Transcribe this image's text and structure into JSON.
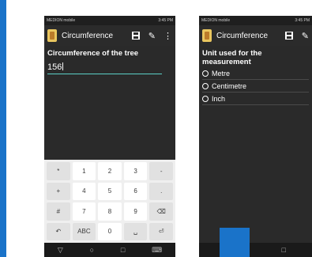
{
  "phone1": {
    "status": {
      "carrier": "MEDION mobile",
      "right": "3:45 PM"
    },
    "appbar": {
      "title": "Circumference"
    },
    "main": {
      "label": "Circumference of the tree",
      "input_value": "156"
    },
    "keyboard": {
      "keys": [
        "*",
        "1",
        "2",
        "3",
        "-",
        "+",
        "4",
        "5",
        "6",
        ".",
        "#",
        "7",
        "8",
        "9",
        "⌫",
        "↶",
        "ABC",
        "0",
        "␣",
        "⏎"
      ]
    },
    "navbar": {
      "back": "▽",
      "home": "○",
      "recent": "□",
      "keyboard": "⌨"
    }
  },
  "phone2": {
    "status": {
      "carrier": "MEDION mobile",
      "right": "3:45 PM"
    },
    "appbar": {
      "title": "Circumference"
    },
    "main": {
      "label": "Unit used for the measurement",
      "options": [
        "Metre",
        "Centimetre",
        "Inch"
      ]
    },
    "navbar": {
      "home": "○",
      "recent": "□"
    }
  },
  "colors": {
    "accent_blue": "#1a73c9",
    "input_underline": "#5bd0c6",
    "phone_bg": "#2a2a2a",
    "keyboard_bg": "#efefef"
  }
}
